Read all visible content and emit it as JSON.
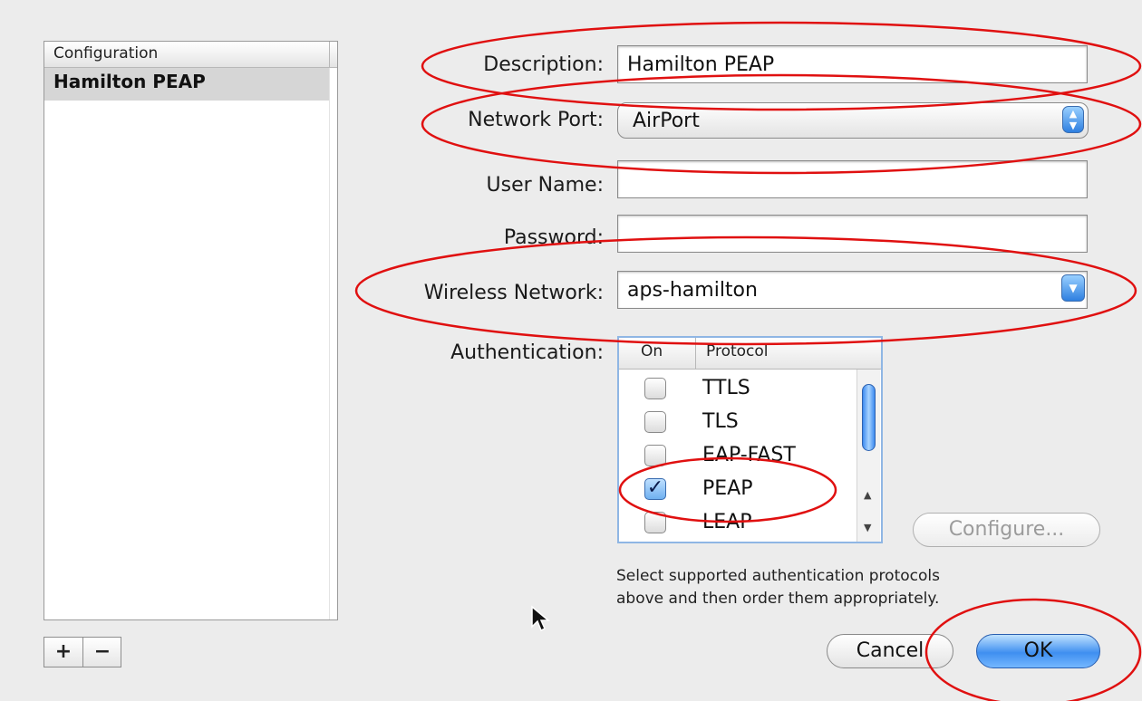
{
  "configuration_list": {
    "header": "Configuration",
    "items": [
      {
        "label": "Hamilton PEAP",
        "selected": true
      }
    ],
    "add_label": "+",
    "remove_label": "−"
  },
  "form": {
    "description": {
      "label": "Description:",
      "value": "Hamilton PEAP"
    },
    "network_port": {
      "label": "Network Port:",
      "value": "AirPort"
    },
    "user_name": {
      "label": "User Name:",
      "value": ""
    },
    "password": {
      "label": "Password:",
      "value": ""
    },
    "wireless_network": {
      "label": "Wireless Network:",
      "value": "aps-hamilton"
    },
    "authentication": {
      "label": "Authentication:",
      "col_on": "On",
      "col_protocol": "Protocol",
      "protocols": [
        {
          "name": "TTLS",
          "on": false,
          "check_mark": ""
        },
        {
          "name": "TLS",
          "on": false,
          "check_mark": ""
        },
        {
          "name": "EAP-FAST",
          "on": false,
          "check_mark": ""
        },
        {
          "name": "PEAP",
          "on": true,
          "check_mark": "✓"
        },
        {
          "name": "LEAP",
          "on": false,
          "check_mark": ""
        }
      ]
    },
    "configure_label": "Configure...",
    "help_text": "Select supported authentication protocols above and then order them appropriately."
  },
  "buttons": {
    "cancel_label": "Cancel",
    "ok_label": "OK"
  },
  "colors": {
    "annotation": "#e01010",
    "accent": "#3f8ff0",
    "selection": "#d6d6d6"
  }
}
